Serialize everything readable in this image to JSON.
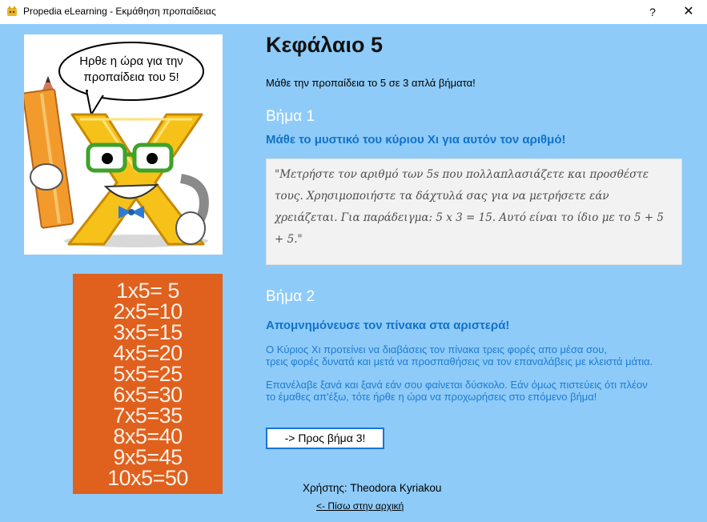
{
  "window": {
    "title": "Propedia eLearning - Εκμάθηση προπαίδειας",
    "help_label": "?",
    "close_label": "✕"
  },
  "mascot": {
    "speech": [
      "Ηρθε η ώρα για την",
      "προπαίδεια του 5!"
    ],
    "letter": "X"
  },
  "times_table": [
    "1x5= 5",
    "2x5=10",
    "3x5=15",
    "4x5=20",
    "5x5=25",
    "6x5=30",
    "7x5=35",
    "8x5=40",
    "9x5=45",
    "10x5=50"
  ],
  "content": {
    "chapter_title": "Κεφάλαιο 5",
    "intro": "Μάθε την προπαίδεια το 5 σε 3 απλά βήματα!",
    "step1": {
      "title": "Βήμα 1",
      "subtitle": "Μάθε το μυστικό του κύριου Χι για αυτόν τον αριθμό!",
      "quote": "\"Μετρήστε τον αριθμό των 5s που πολλαπλασιάζετε και προσθέστε τους. Χρησιμοποιήστε τα δάχτυλά σας για να μετρήσετε εάν χρειάζεται. Για παράδειγμα: 5 x 3 = 15. Αυτό είναι το ίδιο με το 5 + 5 + 5.\""
    },
    "step2": {
      "title": "Βήμα 2",
      "subtitle": "Απομνημόνευσε τον πίνακα στα αριστερά!",
      "para1_line1": "Ο Κύριος Χι προτείνει να διαβάσεις τον πίνακα τρεις φορές απο μέσα σου,",
      "para1_line2": "τρεις φορές δυνατά και μετά να προσπαθήσεις να τον επαναλάβεις με κλειστά μάτια.",
      "para2_line1": "Επανέλαβε ξανά και ξανά εάν σου φαίνεται δύσκολο. Εάν όμως πιστεύεις ότι πλέον",
      "para2_line2": "το έμαθες απ'έξω, τότε ήρθε η ώρα να προχωρήσεις στο επόμενο βήμα!"
    },
    "next_button": "-> Προς βήμα 3!"
  },
  "footer": {
    "user_label": "Χρήστης: Theodora Kyriakou",
    "back_link": "<- Πίσω στην αρχική"
  },
  "colors": {
    "background": "#8ECBF8",
    "accent_blue": "#1372C9",
    "table_orange": "#E0601E"
  }
}
